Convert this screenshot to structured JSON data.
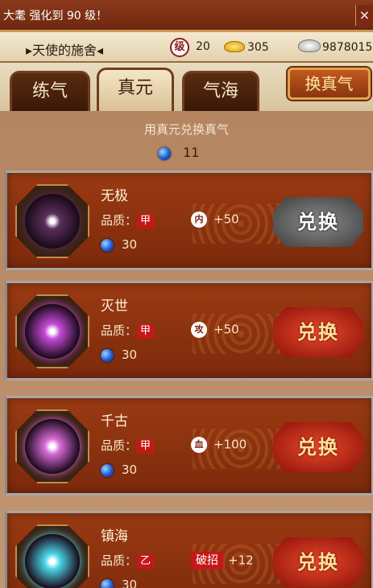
{
  "marquee": {
    "text": "大耄 强化到 90 级！",
    "close_label": "×"
  },
  "player": {
    "name": "天使的施舍",
    "level_icon": "级",
    "level": "20",
    "gold": "305",
    "silver": "9878015"
  },
  "tabs": [
    {
      "label": "练气",
      "active": false
    },
    {
      "label": "真元",
      "active": true
    },
    {
      "label": "气海",
      "active": false
    }
  ],
  "exchange_button": "换真气",
  "main": {
    "hint": "用真元兑换真气",
    "balance": "11"
  },
  "items": [
    {
      "name": "无极",
      "quality_label": "品质：",
      "grade": "甲",
      "stat_icon": "内",
      "stat_value": "+50",
      "cost": "30",
      "button": "兑换",
      "button_state": "disabled",
      "gem_color": "#5a2f5a"
    },
    {
      "name": "灭世",
      "quality_label": "品质：",
      "grade": "甲",
      "stat_icon": "攻",
      "stat_value": "+50",
      "cost": "30",
      "button": "兑换",
      "button_state": "enabled",
      "gem_color": "#c64ad8"
    },
    {
      "name": "千古",
      "quality_label": "品质：",
      "grade": "甲",
      "stat_icon": "血",
      "stat_value": "+100",
      "cost": "30",
      "button": "兑换",
      "button_state": "enabled",
      "gem_color": "#d86ad8"
    },
    {
      "name": "镇海",
      "quality_label": "品质：",
      "grade": "乙",
      "stat_icon": "破招",
      "stat_value": "+12",
      "cost": "30",
      "button": "兑换",
      "button_state": "enabled",
      "gem_color": "#4ad6e8"
    }
  ]
}
